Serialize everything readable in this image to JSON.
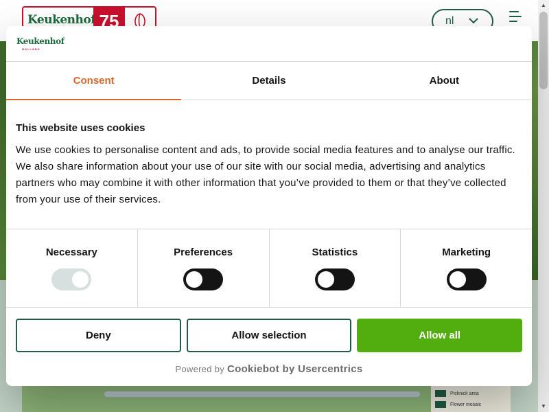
{
  "site": {
    "logo_word": "Keukenhof",
    "logo_number": "75",
    "language": "nl",
    "map_legend": [
      "Picknick area",
      "Flower mosaic"
    ]
  },
  "dialog": {
    "logo_word": "Keukenhof",
    "logo_sub": "HOLLAND",
    "tabs": [
      {
        "label": "Consent",
        "active": true
      },
      {
        "label": "Details",
        "active": false
      },
      {
        "label": "About",
        "active": false
      }
    ],
    "title": "This website uses cookies",
    "text": "We use cookies to personalise content and ads, to provide social media features and to analyse our traffic. We also share information about your use of our site with our social media, advertising and analytics partners who may combine it with other information that you’ve provided to them or that they’ve collected from your use of their services.",
    "categories": [
      {
        "label": "Necessary",
        "checked": true,
        "disabled": true
      },
      {
        "label": "Preferences",
        "checked": false,
        "disabled": false
      },
      {
        "label": "Statistics",
        "checked": false,
        "disabled": false
      },
      {
        "label": "Marketing",
        "checked": false,
        "disabled": false
      }
    ],
    "buttons": {
      "deny": "Deny",
      "allow_selection": "Allow selection",
      "allow_all": "Allow all"
    },
    "powered_prefix": "Powered by",
    "powered_brand": "Cookiebot by Usercentrics"
  },
  "colors": {
    "accent_tab": "#d6682d",
    "brand_green": "#1f5d45",
    "allow_all": "#52ae0f",
    "brand_red": "#c8102e"
  }
}
